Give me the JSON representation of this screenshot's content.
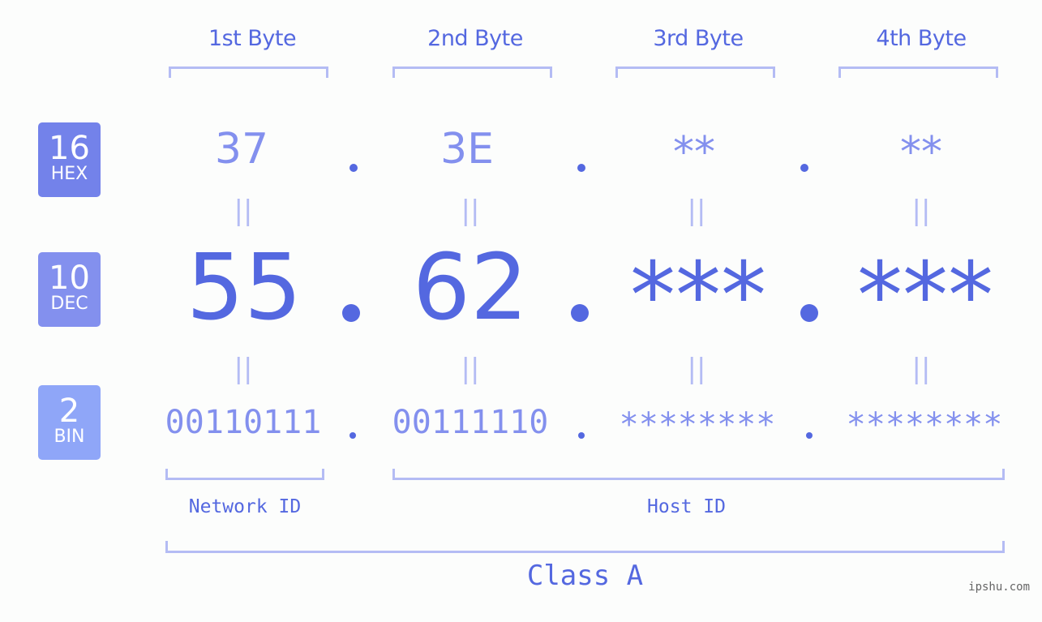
{
  "colors": {
    "primary": "#5468e0",
    "secondary": "#8390ee",
    "bracket": "#b4bcf4",
    "hex_badge": "#7382ea",
    "dec_badge": "#8390ee",
    "bin_badge": "#8fa6f8",
    "background": "#fcfdfc"
  },
  "byte_headers": [
    "1st Byte",
    "2nd Byte",
    "3rd Byte",
    "4th Byte"
  ],
  "rows": {
    "hex": {
      "badge_number": "16",
      "badge_label": "HEX",
      "values": [
        "37",
        "3E",
        "**",
        "**"
      ]
    },
    "dec": {
      "badge_number": "10",
      "badge_label": "DEC",
      "values": [
        "55",
        "62",
        "***",
        "***"
      ]
    },
    "bin": {
      "badge_number": "2",
      "badge_label": "BIN",
      "values": [
        "00110111",
        "00111110",
        "********",
        "********"
      ]
    }
  },
  "equals_symbol": "||",
  "segments": {
    "network_id": "Network ID",
    "host_id": "Host ID"
  },
  "ip_class": "Class A",
  "watermark": "ipshu.com"
}
